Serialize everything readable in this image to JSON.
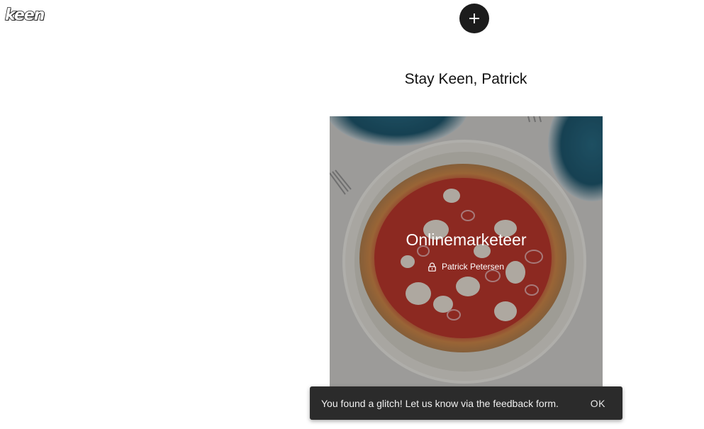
{
  "header": {
    "logo_text": "keen",
    "add_button_icon": "plus-icon"
  },
  "main": {
    "greeting": "Stay Keen, Patrick"
  },
  "card": {
    "title": "Onlinemarketeer",
    "owner": "Patrick Petersen",
    "owner_icon": "lock-icon",
    "image": "pizza-photo"
  },
  "toast": {
    "message": "You found a glitch! Let us know via the feedback form.",
    "ok_label": "OK"
  }
}
